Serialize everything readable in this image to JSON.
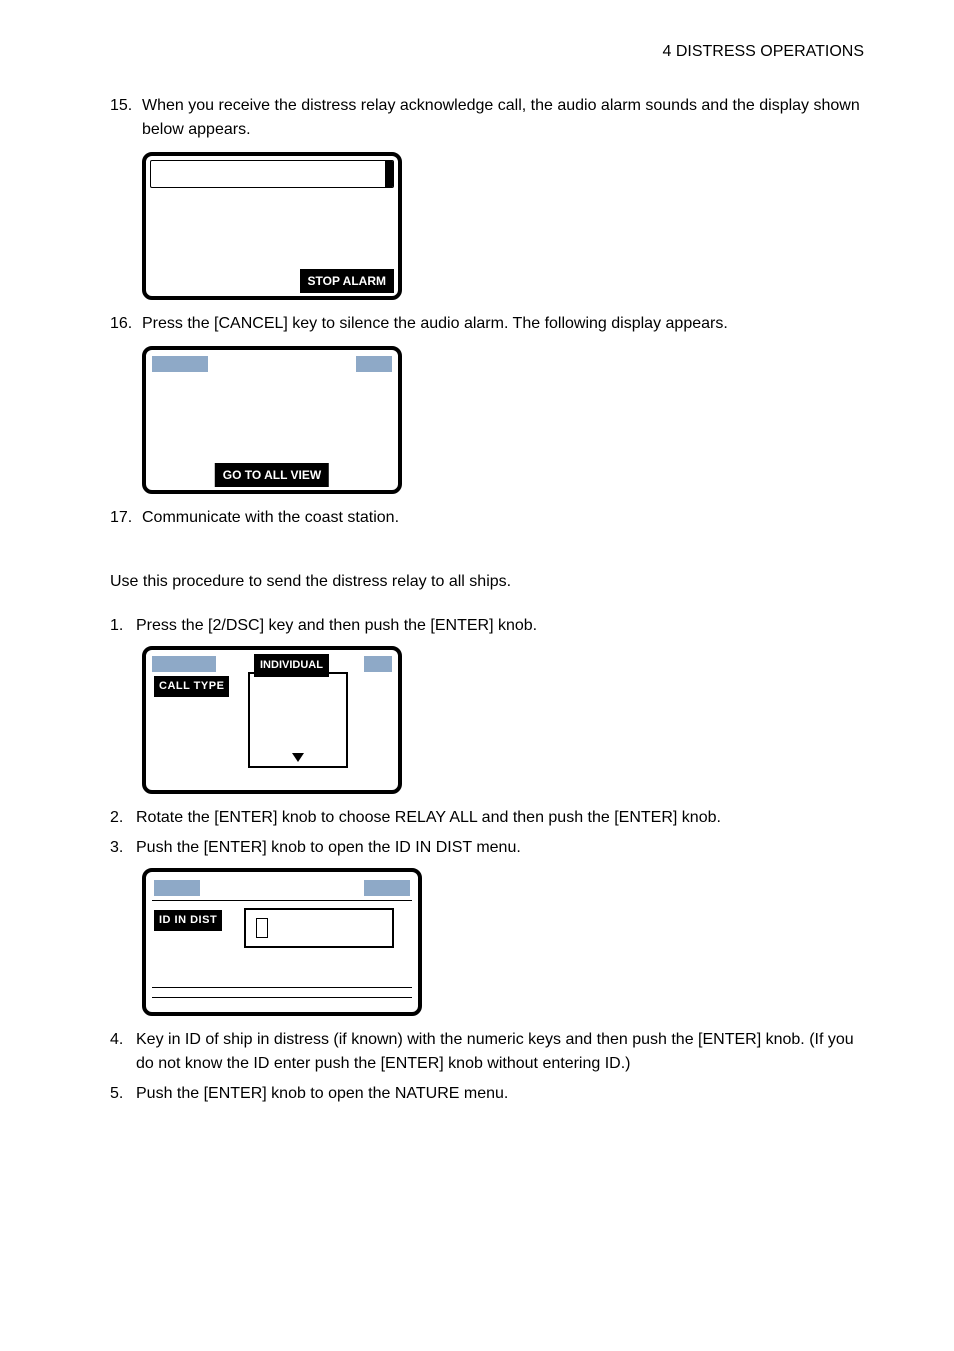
{
  "header": {
    "section": "4  DISTRESS OPERATIONS"
  },
  "steps": {
    "s15": "When you receive the distress relay acknowledge call, the audio alarm sounds and the display shown below appears.",
    "s15num": "15.",
    "lcd1": {
      "stop_alarm": "STOP ALARM"
    },
    "s16": "Press the [CANCEL] key to silence the audio alarm. The following display appears.",
    "s16num": "16.",
    "lcd2": {
      "go_all_view": "GO TO ALL VIEW"
    },
    "s17": "Communicate with the coast station.",
    "s17num": "17.",
    "intro2": "Use this procedure to send the distress relay to all ships.",
    "o1num": "1.",
    "o1": "Press the [2/DSC] key and then push the [ENTER] knob.",
    "lcd3": {
      "individual": "INDIVIDUAL",
      "call_type": "CALL TYPE"
    },
    "o2num": "2.",
    "o2": "Rotate the [ENTER] knob to choose RELAY ALL and then push the [ENTER] knob.",
    "o3num": "3.",
    "o3": "Push the [ENTER] knob to open the ID IN DIST menu.",
    "lcd4": {
      "id_in_dist": "ID IN DIST"
    },
    "o4num": "4.",
    "o4": "Key in ID of ship in distress (if known) with the numeric keys and then push the [ENTER] knob. (If you do not know the ID enter push the [ENTER] knob without entering ID.)",
    "o5num": "5.",
    "o5": "Push the [ENTER] knob to open the NATURE menu."
  }
}
